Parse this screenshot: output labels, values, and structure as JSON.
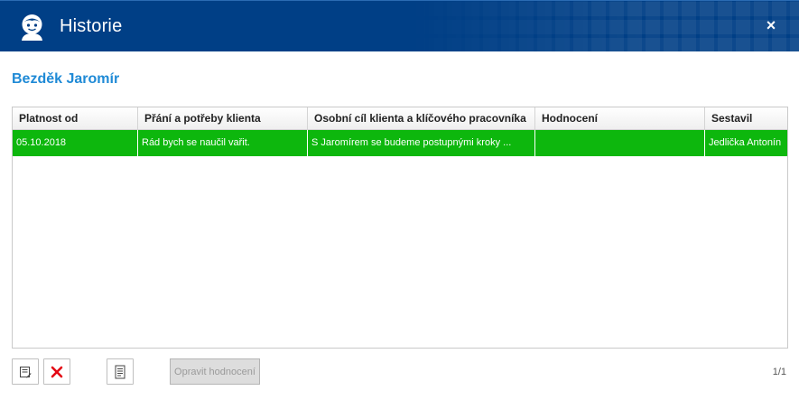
{
  "window": {
    "title": "Historie",
    "close_label": "×"
  },
  "client": {
    "name": "Bezděk Jaromír"
  },
  "table": {
    "columns": [
      "Platnost od",
      "Přání a potřeby klienta",
      "Osobní cíl klienta a klíčového pracovníka",
      "Hodnocení",
      "Sestavil"
    ],
    "rows": [
      [
        "05.10.2018",
        "Rád bych se naučil vařit.",
        "S Jaromírem se budeme postupnými kroky ...",
        "",
        "Jedlička Antonín"
      ]
    ],
    "selected_row_color": "#0db70d"
  },
  "toolbar": {
    "fix_rating_label": "Opravit hodnocení",
    "edit_icon": "edit-note-icon",
    "delete_icon": "delete-x-icon",
    "document_icon": "document-icon"
  },
  "pager": {
    "text": "1/1"
  },
  "colors": {
    "titlebar": "#003f86",
    "accent": "#1f8ad6",
    "delete": "#e30613"
  }
}
